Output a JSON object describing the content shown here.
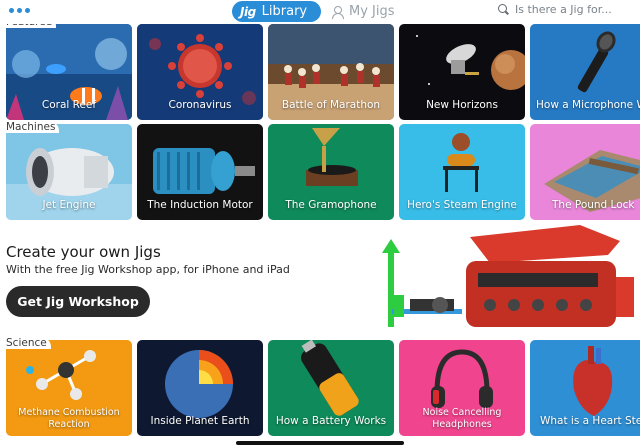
{
  "topbar": {
    "library_label": "Library",
    "logo_text": "Jig",
    "myjigs_label": "My Jigs",
    "search_placeholder": "Is there a Jig for..."
  },
  "sections": {
    "featured": {
      "label": "Featured",
      "cards": [
        {
          "title": "Coral Reef"
        },
        {
          "title": "Coronavirus"
        },
        {
          "title": "Battle of Marathon"
        },
        {
          "title": "New Horizons"
        },
        {
          "title": "How a Microphone Wo"
        }
      ]
    },
    "machines": {
      "label": "Machines",
      "cards": [
        {
          "title": "Jet Engine"
        },
        {
          "title": "The Induction Motor"
        },
        {
          "title": "The Gramophone"
        },
        {
          "title": "Hero's Steam Engine"
        },
        {
          "title": "The Pound Lock"
        }
      ]
    },
    "science": {
      "label": "Science",
      "cards": [
        {
          "title": "Methane Combustion Reaction"
        },
        {
          "title": "Inside Planet Earth"
        },
        {
          "title": "How a Battery Works"
        },
        {
          "title": "Noise Cancelling Headphones"
        },
        {
          "title": "What is a Heart Ster"
        }
      ]
    }
  },
  "promo": {
    "heading": "Create your own Jigs",
    "subtitle": "With the free Jig Workshop app, for iPhone and iPad",
    "button_label": "Get Jig Workshop"
  },
  "colors": {
    "accent": "#2a8dd8",
    "button_dark": "#2a2a2a"
  }
}
